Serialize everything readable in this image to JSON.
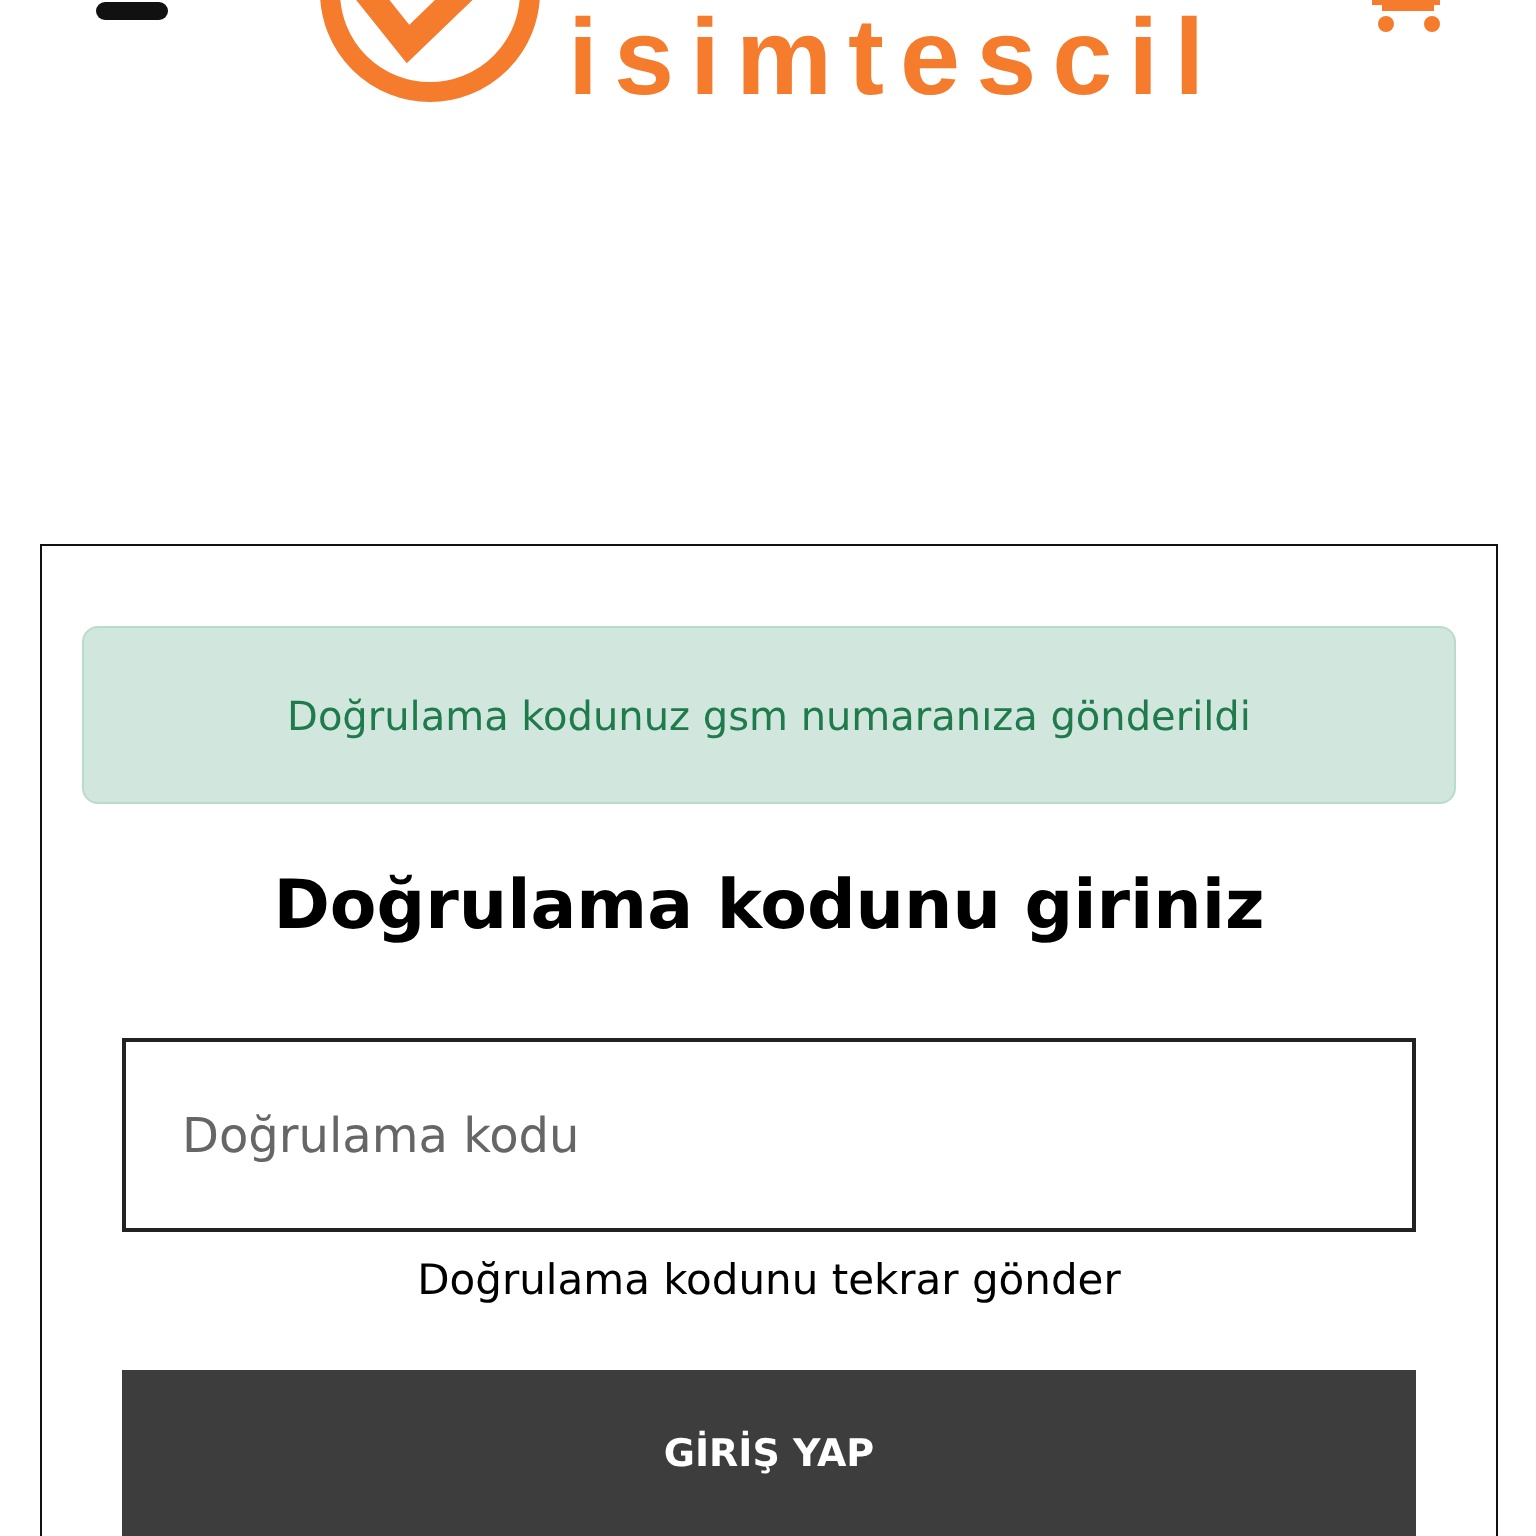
{
  "header": {
    "logo_text": "isimtescil"
  },
  "alert": {
    "kind": "success",
    "message": "Doğrulama kodunuz gsm numaranıza gönderildi"
  },
  "heading": "Doğrulama kodunu giriniz",
  "code_field": {
    "placeholder": "Doğrulama kodu"
  },
  "resend_link": "Doğrulama kodunu tekrar gönder",
  "submit_button": "GİRİŞ YAP"
}
